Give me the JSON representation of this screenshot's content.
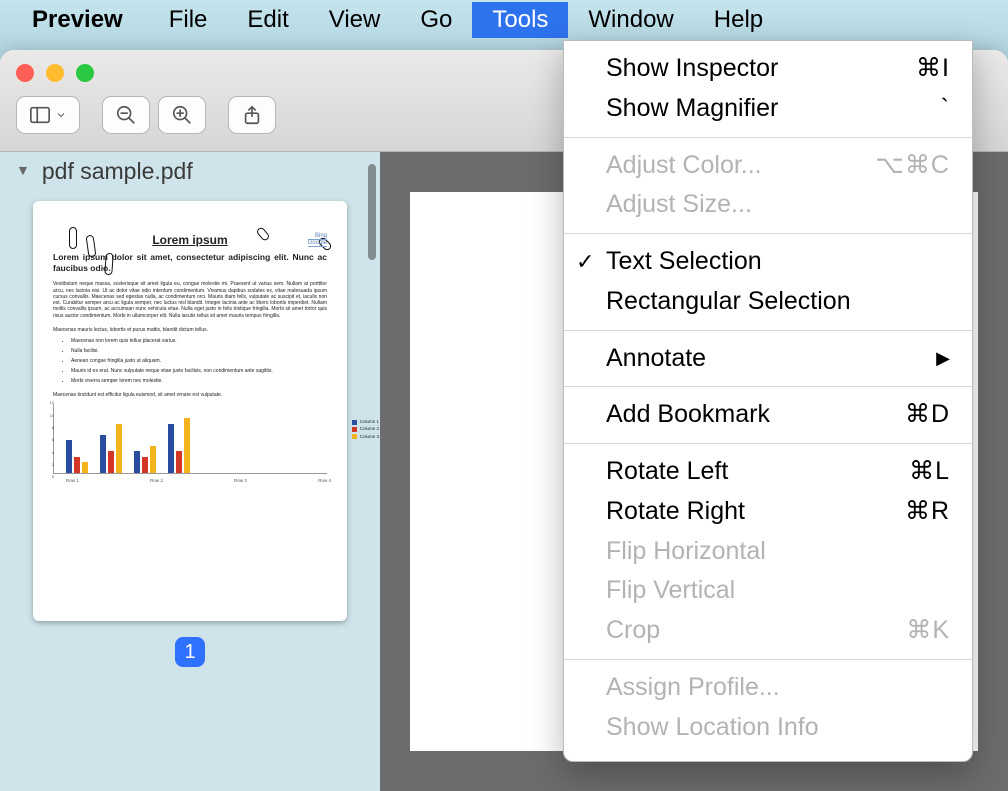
{
  "menubar": {
    "app_name": "Preview",
    "items": [
      "File",
      "Edit",
      "View",
      "Go",
      "Tools",
      "Window",
      "Help"
    ],
    "selected_index": 4
  },
  "window": {
    "document_title": "pdf sample.pdf",
    "page_number": "1"
  },
  "thumbnail": {
    "title": "Lorem ipsum",
    "links": [
      "Bing",
      "Google"
    ],
    "lead": "Lorem ipsum dolor sit amet, consectetur adipiscing elit. Nunc ac faucibus odio.",
    "para": "Vestibulum neque massa, scelerisque sit amet ligula eu, congue molestie mi. Praesent ut varius sem. Nullam at porttitor arcu, nec lacinia nisi. Ut ac dolor vitae odio interdum condimentum. Vivamus dapibus sodales ex, vitae malesuada ipsum cursus convallis. Maecenas sed egestas nulla, ac condimentum orci. Mauris diam felis, vulputate ac suscipit et, iaculis non est. Curabitur semper arcu ac ligula semper, nec luctus nisl blandit. Integer lacinia ante ac libero lobortis imperdiet. Nullam mollis convallis ipsum, ac accumsan nunc vehicula vitae. Nulla eget justo in felis tristique fringilla. Morbi sit amet tortor quis risus auctor condimentum. Morbi in ullamcorper elit. Nulla iaculis tellus sit amet mauris tempus fringilla.",
    "subhead": "Maecenas mauris lectus, lobortis et purus mattis, blandit dictum tellus.",
    "bullets": [
      "Maecenas non lorem quis tellus placerat varius.",
      "Nulla facilisi.",
      "Aenean congue fringilla justo ut aliquam.",
      "Mauris id ex erat. Nunc vulputate neque vitae justo facilisis, non condimentum ante sagittis.",
      "Morbi viverra semper lorem nec molestie."
    ],
    "closing": "Maecenas tincidunt est efficitur ligula euismod, sit amet ornare est vulputate."
  },
  "chart_data": {
    "type": "bar",
    "categories": [
      "Row 1",
      "Row 2",
      "Row 3",
      "Row 4"
    ],
    "series": [
      {
        "name": "Column 1",
        "color": "#2a4da0",
        "values": [
          6,
          7,
          4,
          9
        ]
      },
      {
        "name": "Column 2",
        "color": "#d33526",
        "values": [
          3,
          4,
          3,
          4
        ]
      },
      {
        "name": "Column 3",
        "color": "#f3b41b",
        "values": [
          2,
          9,
          5,
          10
        ]
      }
    ],
    "ylim": [
      0,
      12
    ],
    "yticks": [
      0,
      2,
      4,
      6,
      8,
      10,
      12
    ]
  },
  "tools_menu": [
    {
      "label": "Show Inspector",
      "shortcut": "⌘I"
    },
    {
      "label": "Show Magnifier",
      "shortcut": "`"
    },
    {
      "sep": true
    },
    {
      "label": "Adjust Color...",
      "shortcut": "⌥⌘C",
      "disabled": true
    },
    {
      "label": "Adjust Size...",
      "disabled": true
    },
    {
      "sep": true
    },
    {
      "label": "Text Selection",
      "checked": true
    },
    {
      "label": "Rectangular Selection"
    },
    {
      "sep": true
    },
    {
      "label": "Annotate",
      "submenu": true
    },
    {
      "sep": true
    },
    {
      "label": "Add Bookmark",
      "shortcut": "⌘D"
    },
    {
      "sep": true
    },
    {
      "label": "Rotate Left",
      "shortcut": "⌘L"
    },
    {
      "label": "Rotate Right",
      "shortcut": "⌘R"
    },
    {
      "label": "Flip Horizontal",
      "disabled": true
    },
    {
      "label": "Flip Vertical",
      "disabled": true
    },
    {
      "label": "Crop",
      "shortcut": "⌘K",
      "disabled": true
    },
    {
      "sep": true
    },
    {
      "label": "Assign Profile...",
      "disabled": true
    },
    {
      "label": "Show Location Info",
      "disabled": true
    }
  ]
}
